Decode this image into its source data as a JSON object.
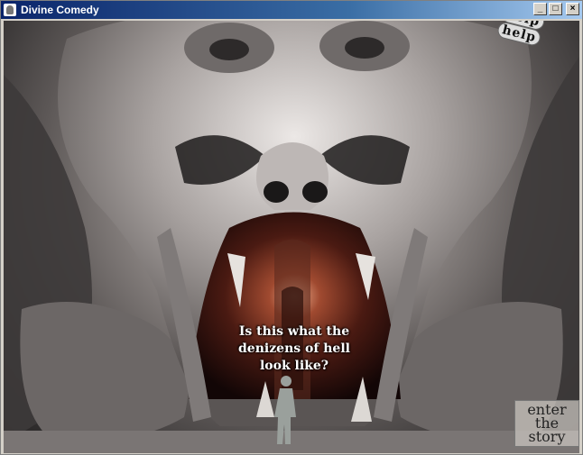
{
  "window": {
    "title": "Divine Comedy",
    "controls": {
      "minimize": "_",
      "maximize": "□",
      "close": "×"
    }
  },
  "scene": {
    "help": "help",
    "caption": "Is this what the denizens of hell look like?",
    "enter": {
      "line1": "enter",
      "line2": "the",
      "line3": "story"
    }
  }
}
